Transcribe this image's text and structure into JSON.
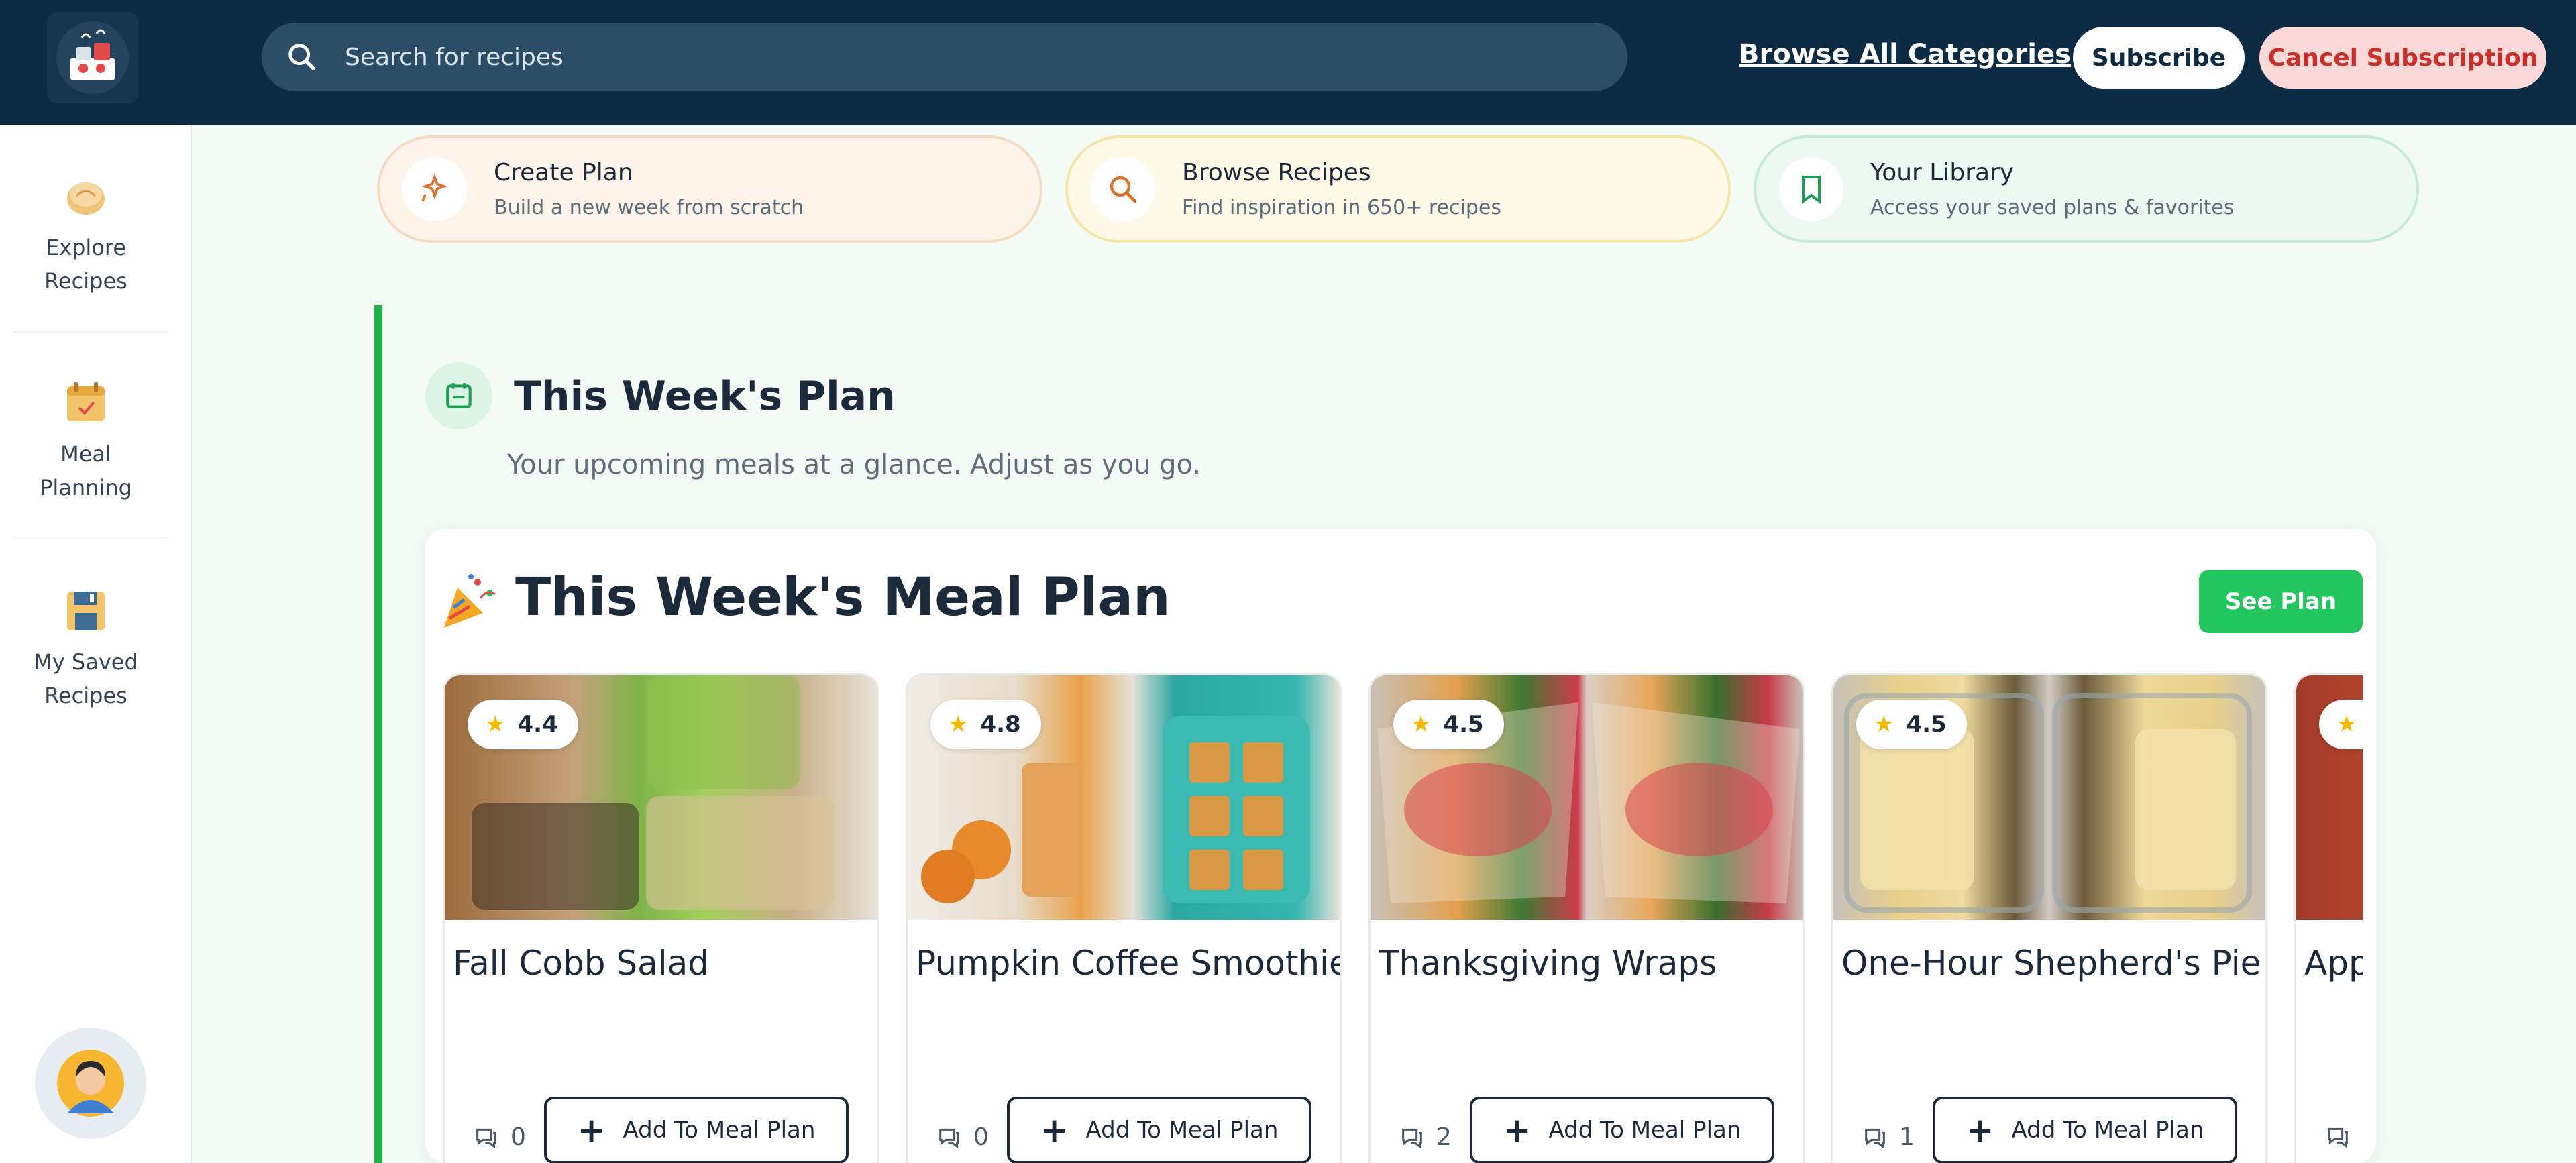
{
  "topbar": {
    "search_placeholder": "Search for recipes",
    "browse_all": "Browse All Categories",
    "subscribe": "Subscribe",
    "cancel_subscription": "Cancel Subscription"
  },
  "sidebar": {
    "items": [
      {
        "label": "Explore Recipes",
        "icon": "bread-icon"
      },
      {
        "label": "Meal Planning",
        "icon": "calendar-icon"
      },
      {
        "label": "My Saved Recipes",
        "icon": "save-icon"
      }
    ]
  },
  "quick_actions": [
    {
      "title": "Create Plan",
      "subtitle": "Build a new week from scratch",
      "icon": "sparkle-icon",
      "color": "#d9722f"
    },
    {
      "title": "Browse Recipes",
      "subtitle": "Find inspiration in 650+ recipes",
      "icon": "search-icon",
      "color": "#d9722f"
    },
    {
      "title": "Your Library",
      "subtitle": "Access your saved plans & favorites",
      "icon": "bookmark-icon",
      "color": "#1f9d55"
    }
  ],
  "section": {
    "title": "This Week's Plan",
    "subtitle": "Your upcoming meals at a glance. Adjust as you go."
  },
  "meal_plan": {
    "title": "This Week's Meal Plan",
    "see_plan": "See Plan",
    "add_label": "Add To Meal Plan",
    "cards": [
      {
        "title": "Fall Cobb Salad",
        "rating": "4.4",
        "comments": "0"
      },
      {
        "title": "Pumpkin Coffee Smoothie",
        "rating": "4.8",
        "comments": "0"
      },
      {
        "title": "Thanksgiving Wraps",
        "rating": "4.5",
        "comments": "2"
      },
      {
        "title": "One-Hour Shepherd's Pie",
        "rating": "4.5",
        "comments": "1"
      },
      {
        "title": "App",
        "rating": "",
        "comments": ""
      }
    ]
  },
  "colors": {
    "topbar": "#0d2b43",
    "accent_green": "#22c55e",
    "cancel_text": "#c9302c"
  }
}
